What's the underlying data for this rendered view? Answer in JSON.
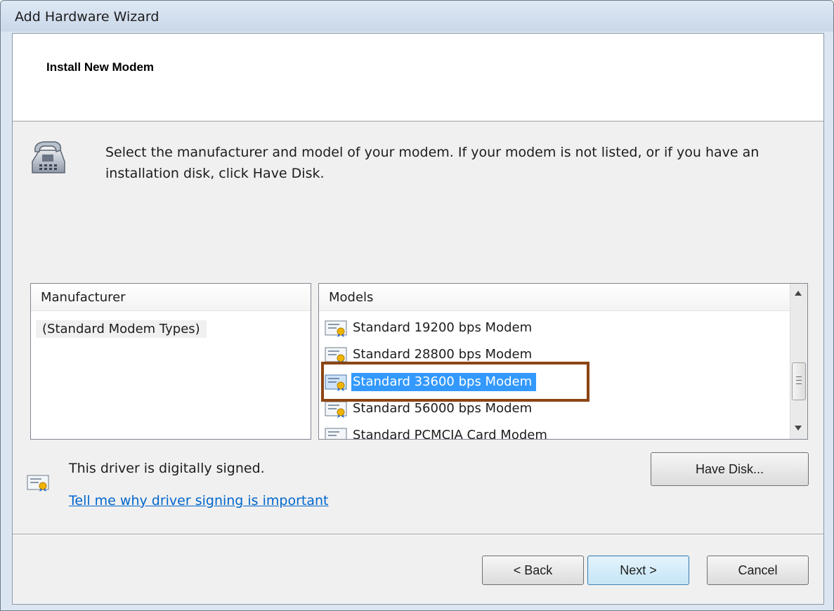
{
  "window": {
    "title": "Add Hardware Wizard"
  },
  "header": {
    "title": "Install New Modem"
  },
  "instructions": "Select the manufacturer and model of your modem. If your modem is not listed, or if you have an installation disk, click Have Disk.",
  "manufacturer_list": {
    "header": "Manufacturer",
    "items": [
      "(Standard Modem Types)"
    ],
    "selected": "(Standard Modem Types)"
  },
  "models_list": {
    "header": "Models",
    "items": [
      "Standard 19200 bps Modem",
      "Standard 28800 bps Modem",
      "Standard 33600 bps Modem",
      "Standard 56000 bps Modem",
      "Standard PCMCIA Card Modem"
    ],
    "selected": "Standard 33600 bps Modem"
  },
  "driver": {
    "signed_text": "This driver is digitally signed.",
    "link_text": "Tell me why driver signing is important"
  },
  "buttons": {
    "have_disk": "Have Disk...",
    "back": "< Back",
    "next": "Next >",
    "cancel": "Cancel"
  },
  "colors": {
    "selection": "#3399ff",
    "link": "#0066cc",
    "highlight_outline": "#8b4513"
  },
  "icons": {
    "modem": "modem-phone-icon",
    "certificate": "certificate-icon"
  }
}
